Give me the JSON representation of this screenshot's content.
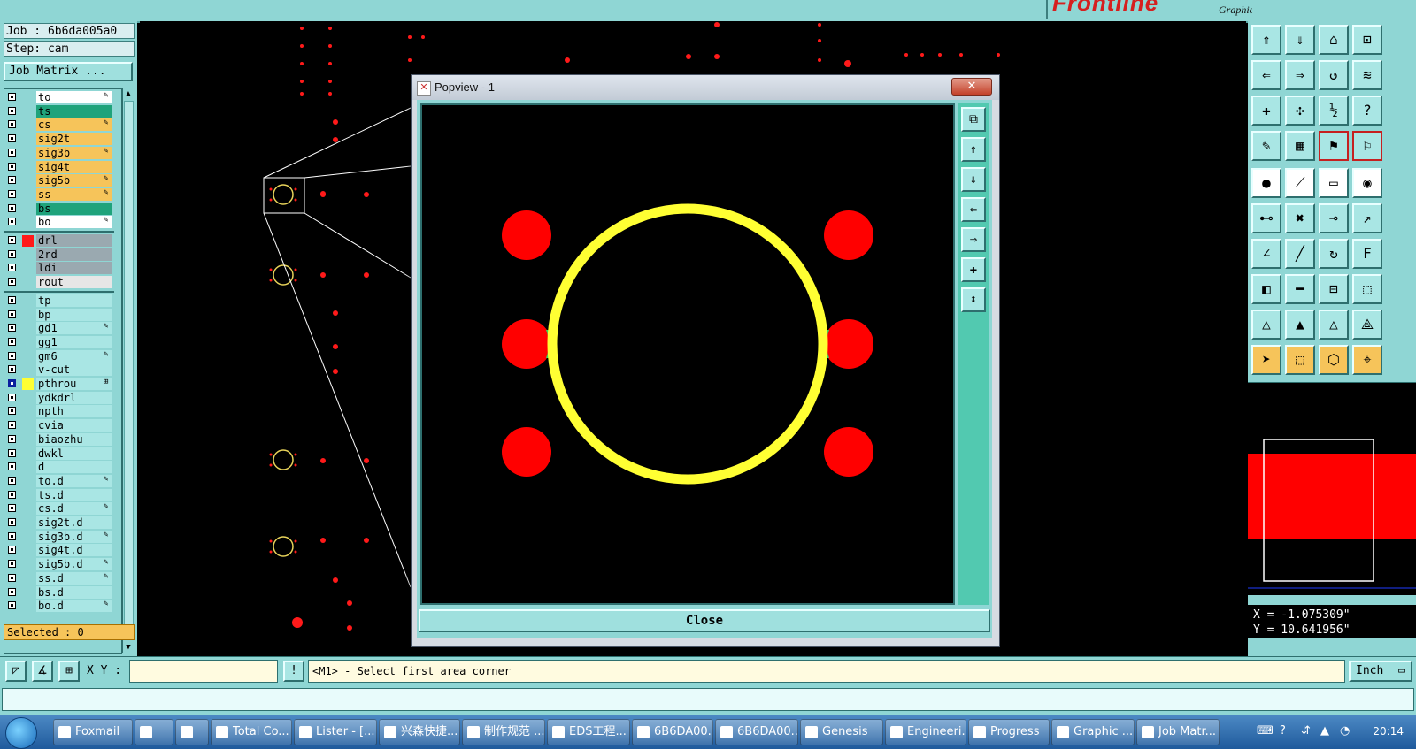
{
  "app": {
    "logo_word": "Frontline",
    "logo_subtitle": "Graphic Editor"
  },
  "job_info": {
    "job": "Job : 6b6da005a0",
    "step": "Step: cam",
    "matrix_button": "Job Matrix ..."
  },
  "layers": [
    {
      "name": "to",
      "bg": "#ffffff",
      "mark": "✎"
    },
    {
      "name": "ts",
      "bg": "#1fa37b",
      "mark": ""
    },
    {
      "name": "cs",
      "bg": "#f6c45a",
      "mark": "✎"
    },
    {
      "name": "sig2t",
      "bg": "#f6c45a",
      "mark": ""
    },
    {
      "name": "sig3b",
      "bg": "#f6c45a",
      "mark": "✎"
    },
    {
      "name": "sig4t",
      "bg": "#f6c45a",
      "mark": ""
    },
    {
      "name": "sig5b",
      "bg": "#f6c45a",
      "mark": "✎"
    },
    {
      "name": "ss",
      "bg": "#f6c45a",
      "mark": "✎"
    },
    {
      "name": "bs",
      "bg": "#1fa37b",
      "mark": ""
    },
    {
      "name": "bo",
      "bg": "#ffffff",
      "mark": "✎"
    },
    {
      "name": "drl",
      "bg": "#9aa9b0",
      "mark": "",
      "swatch": "#ff1a1a"
    },
    {
      "name": "2rd",
      "bg": "#9aa9b0",
      "mark": ""
    },
    {
      "name": "ldi",
      "bg": "#9aa9b0",
      "mark": ""
    },
    {
      "name": "rout",
      "bg": "#e6e6e6",
      "mark": ""
    },
    {
      "name": "tp",
      "bg": "#a9e6e4",
      "mark": ""
    },
    {
      "name": "bp",
      "bg": "#a9e6e4",
      "mark": ""
    },
    {
      "name": "gd1",
      "bg": "#a9e6e4",
      "mark": "✎"
    },
    {
      "name": "gg1",
      "bg": "#a9e6e4",
      "mark": ""
    },
    {
      "name": "gm6",
      "bg": "#a9e6e4",
      "mark": "✎"
    },
    {
      "name": "v-cut",
      "bg": "#a9e6e4",
      "mark": ""
    },
    {
      "name": "pthrou",
      "bg": "#a9e6e4",
      "mark": "⊞",
      "swatch": "#ffff33",
      "checked": true
    },
    {
      "name": "ydkdrl",
      "bg": "#a9e6e4",
      "mark": ""
    },
    {
      "name": "npth",
      "bg": "#a9e6e4",
      "mark": ""
    },
    {
      "name": "cvia",
      "bg": "#a9e6e4",
      "mark": ""
    },
    {
      "name": "biaozhu",
      "bg": "#a9e6e4",
      "mark": ""
    },
    {
      "name": "dwkl",
      "bg": "#a9e6e4",
      "mark": ""
    },
    {
      "name": "d",
      "bg": "#a9e6e4",
      "mark": ""
    },
    {
      "name": "to.d",
      "bg": "#a9e6e4",
      "mark": "✎"
    },
    {
      "name": "ts.d",
      "bg": "#a9e6e4",
      "mark": ""
    },
    {
      "name": "cs.d",
      "bg": "#a9e6e4",
      "mark": "✎"
    },
    {
      "name": "sig2t.d",
      "bg": "#a9e6e4",
      "mark": ""
    },
    {
      "name": "sig3b.d",
      "bg": "#a9e6e4",
      "mark": "✎"
    },
    {
      "name": "sig4t.d",
      "bg": "#a9e6e4",
      "mark": ""
    },
    {
      "name": "sig5b.d",
      "bg": "#a9e6e4",
      "mark": "✎"
    },
    {
      "name": "ss.d",
      "bg": "#a9e6e4",
      "mark": "✎"
    },
    {
      "name": "bs.d",
      "bg": "#a9e6e4",
      "mark": ""
    },
    {
      "name": "bo.d",
      "bg": "#a9e6e4",
      "mark": "✎"
    }
  ],
  "selected": "Selected : 0",
  "popview": {
    "title": "Popview - 1",
    "close_label": "Close",
    "close_x": "✕"
  },
  "command": {
    "xy_label": "X Y :",
    "xy_value": "",
    "prompt": "<M1> - Select first area corner",
    "units": "Inch"
  },
  "coords": {
    "x": "X = -1.075309\"",
    "y": "Y = 10.641956\""
  },
  "taskbar": {
    "items": [
      "Foxmail",
      "",
      "",
      "Total Co...",
      "Lister - [...",
      "兴森快捷...",
      "制作规范 ...",
      "EDS工程...",
      "6B6DA00...",
      "6B6DA00...",
      "Genesis",
      "Engineeri...",
      "Progress",
      "Graphic ...",
      "Job Matr..."
    ],
    "clock": "20:14"
  },
  "colors": {
    "panel": "#8fd6d4",
    "feature_red": "#ff0000",
    "pad_yellow": "#ffff33",
    "accent_green": "#3adb5a"
  }
}
